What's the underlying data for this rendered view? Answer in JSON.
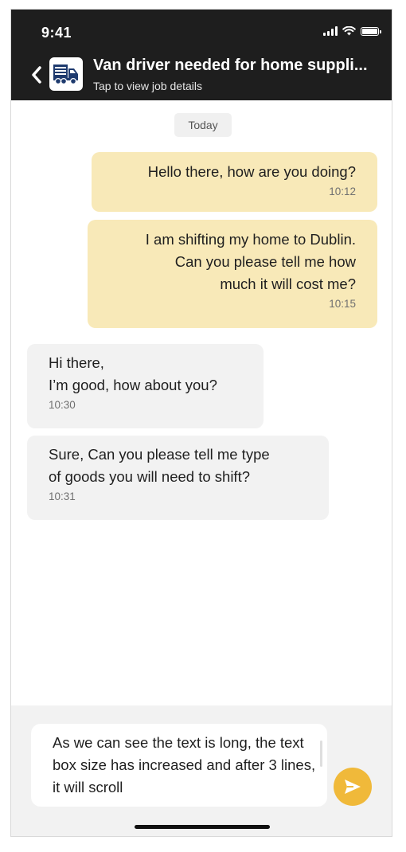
{
  "status_bar": {
    "time": "9:41"
  },
  "header": {
    "title": "Van driver needed for home suppli...",
    "subtitle": "Tap to view job details",
    "back_icon": "chevron-left-icon",
    "thumb_icon": "truck-icon"
  },
  "conversation": {
    "date_label": "Today",
    "messages": [
      {
        "direction": "outgoing",
        "text": "Hello there, how are you doing?",
        "time": "10:12"
      },
      {
        "direction": "outgoing",
        "text": "I am shifting my home to Dublin.\nCan you please tell me how\nmuch it will cost me?",
        "time": "10:15"
      },
      {
        "direction": "incoming",
        "text": "Hi there,\nI’m good, how about you?",
        "time": "10:30"
      },
      {
        "direction": "incoming",
        "text": "Sure, Can you please tell me type\nof goods you will need to shift?",
        "time": "10:31"
      }
    ]
  },
  "composer": {
    "text": "As we can see the text is long, the text box size has increased and after 3 lines, it will scroll",
    "send_icon": "send-icon"
  },
  "colors": {
    "header_bg": "#1e1e1e",
    "outgoing_bubble": "#f8e9b8",
    "incoming_bubble": "#f2f2f2",
    "send_button": "#f0b93a"
  }
}
